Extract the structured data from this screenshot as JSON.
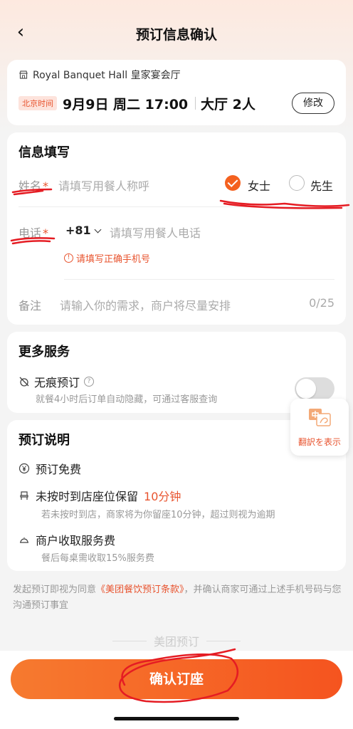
{
  "nav": {
    "title": "预订信息确认",
    "back_icon": "back-arrow-icon"
  },
  "restaurant": {
    "name": "Royal Banquet Hall 皇家宴会厅",
    "time_badge": "北京时间",
    "datetime": "9月9日 周二 17:00",
    "party": "大厅 2人",
    "modify_label": "修改"
  },
  "info": {
    "title": "信息填写",
    "name_label": "姓名",
    "name_placeholder": "请填写用餐人称呼",
    "gender_options": [
      {
        "label": "女士",
        "selected": true
      },
      {
        "label": "先生",
        "selected": false
      }
    ],
    "phone_label": "电话",
    "country_code": "+81",
    "phone_placeholder": "请填写用餐人电话",
    "phone_error": "请填写正确手机号",
    "remark_label": "备注",
    "remark_placeholder": "请输入你的需求，商户将尽量安排",
    "remark_count": "0/25",
    "required_mark": "*"
  },
  "services": {
    "title": "更多服务",
    "item_label": "无痕预订",
    "item_desc": "就餐4小时后订单自动隐藏，可通过客服查询",
    "toggle_on": false
  },
  "booking_notes": {
    "title": "预订说明",
    "free": "预订免费",
    "hold": "未按时到店座位保留",
    "hold_time": "10分钟",
    "hold_desc": "若未按时到店，商家将为你留座10分钟，超过则视为逾期",
    "fee": "商户收取服务费",
    "fee_desc": "餐后每桌需收取15%服务费"
  },
  "terms": {
    "prefix": "发起预订即视为同意",
    "link": "《美团餐饮预订条款》",
    "suffix": "，并确认商家可通过上述手机号码与您沟通预订事宜"
  },
  "brand": "美团预订",
  "confirm_label": "确认订座",
  "translate_label": "翻訳を表示",
  "colors": {
    "accent": "#f4611f",
    "error": "#e8542f",
    "annotation": "#e51c23"
  }
}
